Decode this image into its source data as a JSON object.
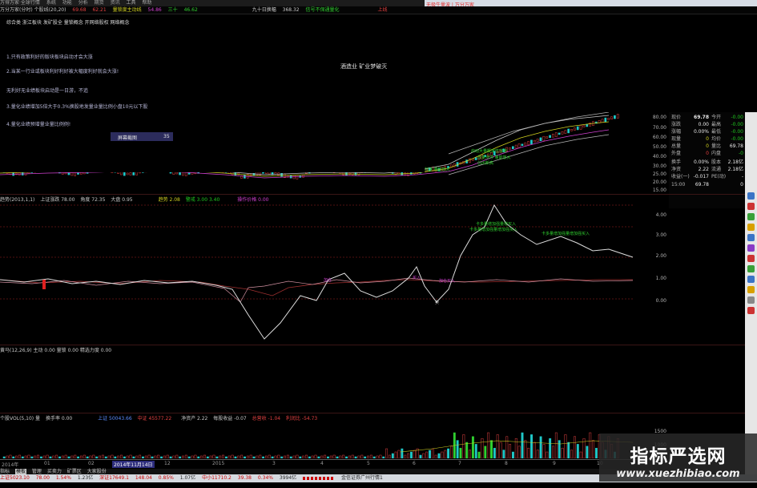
{
  "menu": {
    "items": [
      "万得万家·全球行情",
      "系统",
      "功能",
      "分析",
      "期货",
      "资讯",
      "工具",
      "帮助"
    ],
    "right_text": "无极牛量波 | 万分万家"
  },
  "nav_strip": {
    "items": [
      "万分万家(分时) 个股线(20,20)",
      "69.68",
      "62.21",
      "量锁度主动线",
      "54.86",
      "三十",
      "46.62",
      "九十日换幅",
      "368.32",
      "信号不保通量化",
      "上线"
    ]
  },
  "overlay": {
    "header": "综合类 浙江板块 发矿股全 量锁概念 开网络股权 网络概念",
    "lines": [
      "1.只有政策利好的版块板块启动才会大涨",
      "2.当某一行业或板块利好利好被大幅度利好就会大涨!",
      "无利好无业绩板块启动是一日游，不追",
      "3.量化业绩增加5倍大于0.3%换股地发量业量比例小盘10元以下股",
      "4.量化业绩预增量业量比例例!"
    ],
    "screen_button": "屏幕截图",
    "screen_value": "35",
    "annotation": "酒造业 矿业梦破灭"
  },
  "kline": {
    "axis_labels": [
      "80.00",
      "70.00",
      "60.00",
      "50.00",
      "40.00",
      "30.00",
      "25.00",
      "20.00",
      "15.00"
    ],
    "green_notes": [
      "启动大量概率性突破",
      "放量涨停 量能放大",
      "创出新高",
      "股价加速 量能放大"
    ]
  },
  "indicator1": {
    "header": [
      {
        "text": "趋势(2013,1,1)",
        "color": "#c8c8c8"
      },
      {
        "text": "上证涨跌 78.00",
        "color": "#c8c8c8"
      },
      {
        "text": "角度 72.35",
        "color": "#c8c8c8"
      },
      {
        "text": "大盘 0.95",
        "color": "#c8c8c8"
      },
      {
        "text": "趋势 2.08",
        "color": "#d0d020"
      },
      {
        "text": "警戒 3.00 3.40",
        "color": "#20c820"
      },
      {
        "text": "操作价格 0.00",
        "color": "#d040d0"
      }
    ],
    "axis_labels": [
      "4.00",
      "3.00",
      "2.00",
      "1.00",
      "0.00"
    ],
    "tags": [
      "卡多量增加强量增买入",
      "卡多量增加强量增加强买入",
      "卡多量增加强量增加强买入"
    ],
    "markers": [
      "加仓",
      "买入",
      "加仓买入",
      "卖"
    ]
  },
  "indicator2": {
    "header": "黄马(12,26,9) 主动 0.00 量锁 0.00 精选力度 0.00"
  },
  "volume": {
    "header": [
      {
        "text": "个股VOL(5,10) 量",
        "color": "#c8c8c8"
      },
      {
        "text": "换手率 0.00",
        "color": "#c8c8c8"
      },
      {
        "text": "上证 50043.66",
        "color": "#5a8cff"
      },
      {
        "text": "中证 45577.22",
        "color": "#e04040"
      },
      {
        "text": "净资产 2.22",
        "color": "#c8c8c8"
      },
      {
        "text": "每股收益 -0.07",
        "color": "#c8c8c8"
      },
      {
        "text": "总营收 -1.04",
        "color": "#e04040"
      },
      {
        "text": "利润比 -54.73",
        "color": "#e04040"
      }
    ],
    "axis_labels": [
      "1500",
      "1000",
      "500"
    ],
    "date_labels": [
      "2014年",
      "01",
      "02",
      "2014年11月14日",
      "12",
      "2015",
      "3",
      "4",
      "5",
      "6",
      "7",
      "8",
      "9",
      "10"
    ]
  },
  "quote_panel": {
    "rows": [
      {
        "l1": "现价",
        "v1": "69.78",
        "l2": "今开",
        "v2": "-0.00"
      },
      {
        "l1": "涨跌",
        "v1": "0.00",
        "l2": "最高",
        "v2": "-0.00"
      },
      {
        "l1": "涨幅",
        "v1": "0.00%",
        "l2": "最低",
        "v2": "-0.00"
      },
      {
        "l1": "现量",
        "v1": "0",
        "l2": "均价",
        "v2": "-0.00"
      },
      {
        "l1": "总量",
        "v1": "0",
        "l2": "量比",
        "v2": "69.78"
      },
      {
        "l1": "外盘",
        "v1": "0",
        "l2": "内盘",
        "v2": "-0"
      },
      {
        "l1": "换手",
        "v1": "0.00%",
        "l2": "股本",
        "v2": "2.18亿"
      },
      {
        "l1": "净资",
        "v1": "2.22",
        "l2": "流通",
        "v2": "2.18亿"
      },
      {
        "l1": "收益(一)",
        "v1": "-0.017",
        "l2": "PE(动)",
        "v2": "-"
      },
      {
        "l1": "15:00",
        "v1": "69.78",
        "l2": "",
        "v2": "0"
      }
    ]
  },
  "tabs": {
    "items": [
      "指标",
      "模板",
      "管理",
      "买卖力",
      "矿票区",
      "大家股份"
    ]
  },
  "status_bar": {
    "items": [
      "上证5023.10",
      "78.00",
      "1.54%",
      "1.23亿",
      "深证17649.1",
      "148.04",
      "0.85%",
      "1.07亿",
      "中小11710.2",
      "39.38",
      "0.34%",
      "3994亿",
      "金信证券广州行情1"
    ]
  },
  "watermark": {
    "title": "指标严选网",
    "url": "www.xuezhibiao.com"
  },
  "colors": {
    "up": "#e04040",
    "down": "#20c8c8",
    "bullish_note": "#30d030",
    "accent_magenta": "#d040d0",
    "accent_yellow": "#d0d020"
  }
}
